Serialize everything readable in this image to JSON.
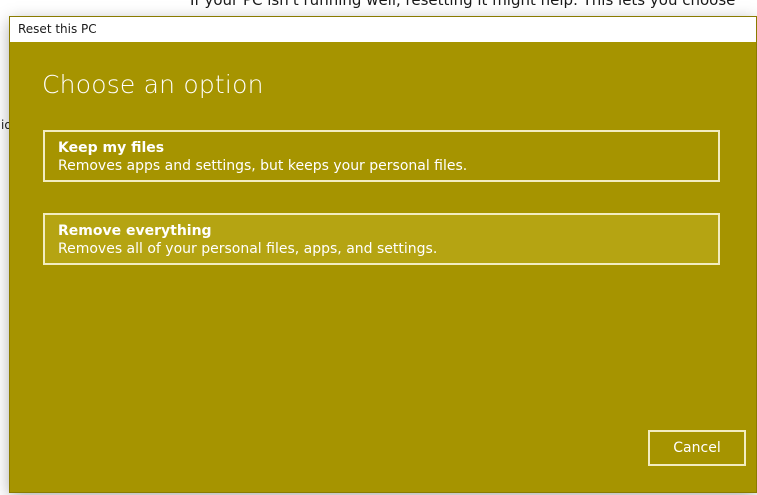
{
  "background": {
    "top_text": "If your PC isn't running well, resetting it might help. This lets you choose",
    "side_text": "io"
  },
  "dialog": {
    "title": "Reset this PC",
    "heading": "Choose an option",
    "accent_color": "#a69400",
    "options": [
      {
        "title": "Keep my files",
        "description": "Removes apps and settings, but keeps your personal files."
      },
      {
        "title": "Remove everything",
        "description": "Removes all of your personal files, apps, and settings."
      }
    ],
    "cancel_label": "Cancel"
  }
}
